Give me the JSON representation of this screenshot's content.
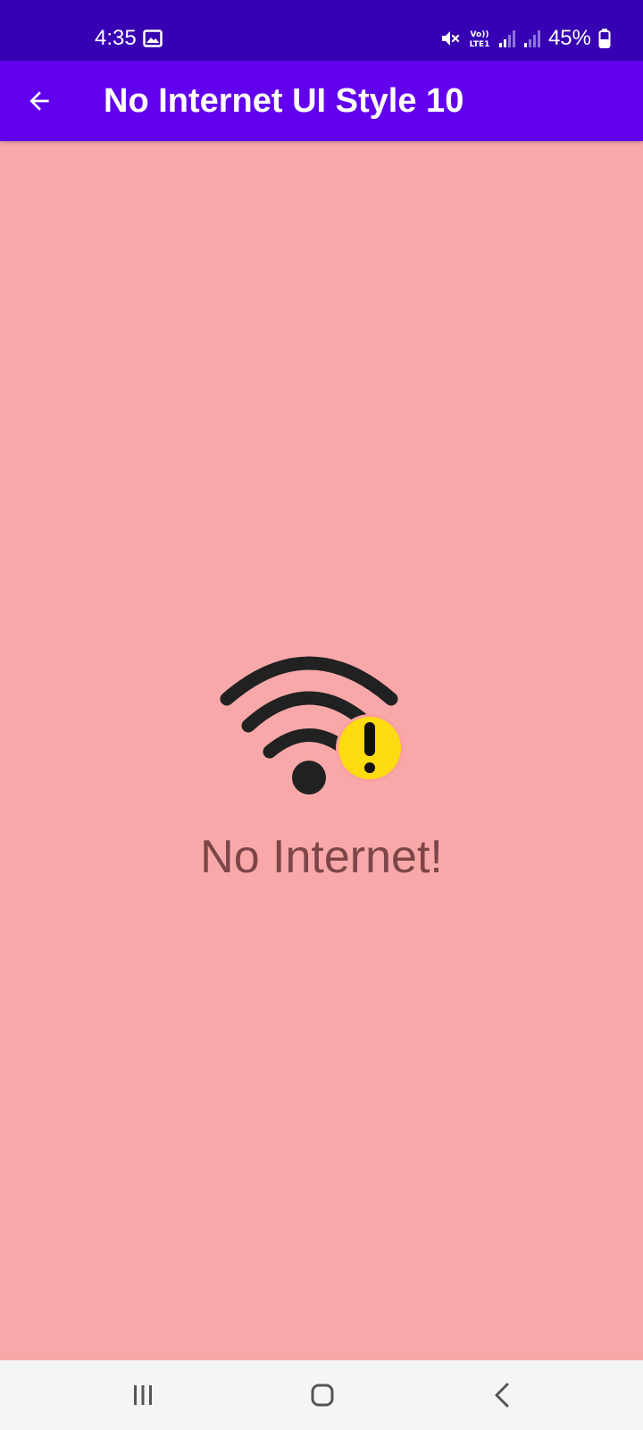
{
  "status_bar": {
    "time": "4:35",
    "battery": "45%",
    "network_label": "Vo)) LTE1",
    "icons": [
      "gallery-icon",
      "mute-icon",
      "volte-icon",
      "signal-icon",
      "signal-icon",
      "battery-icon"
    ]
  },
  "app_bar": {
    "title": "No Internet UI Style 10",
    "back_icon": "arrow-back-icon"
  },
  "content": {
    "icon": "wifi-warning-icon",
    "message": "No Internet!"
  },
  "navigation_bar": {
    "icons": [
      "recents-icon",
      "home-icon",
      "back-icon"
    ]
  },
  "colors": {
    "status_bar": "#3700b3",
    "app_bar": "#6200ee",
    "background": "#f9a8a9",
    "message_text": "#7c4648",
    "warning_badge": "#fddb11",
    "wifi_icon": "#212121",
    "nav_bar": "#f5f5f5"
  }
}
